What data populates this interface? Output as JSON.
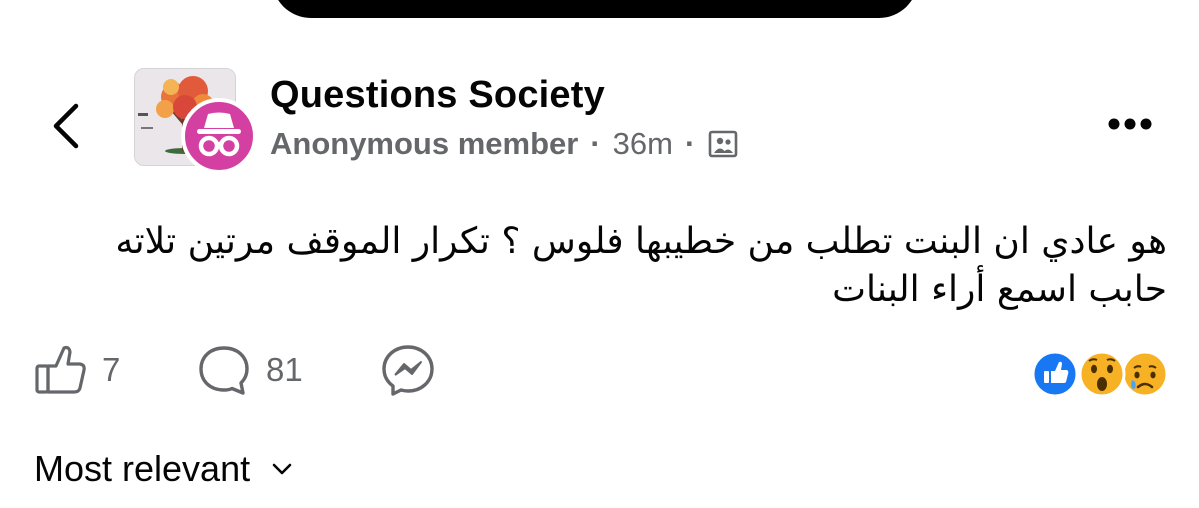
{
  "header": {
    "group_name": "Questions Society",
    "author": "Anonymous member",
    "separator": "·",
    "time": "36m",
    "icons": {
      "back": "chevron-left-icon",
      "audience": "members-photo-icon",
      "more": "more-horizontal-icon",
      "anonymous": "incognito-icon"
    }
  },
  "post": {
    "text": "هو عادي ان البنت تطلب من خطيبها فلوس ؟ تكرار الموقف مرتين تلاته حابب اسمع أراء البنات"
  },
  "actions": {
    "like_count": "7",
    "comment_count": "81"
  },
  "reactions": [
    "like",
    "wow",
    "sad"
  ],
  "comments": {
    "sort_label": "Most relevant"
  },
  "colors": {
    "text_primary": "#050505",
    "text_secondary": "#65676b",
    "anonymous_badge": "#d43fa2",
    "like_blue": "#1877f2",
    "emoji_yellow": "#f7b125"
  }
}
